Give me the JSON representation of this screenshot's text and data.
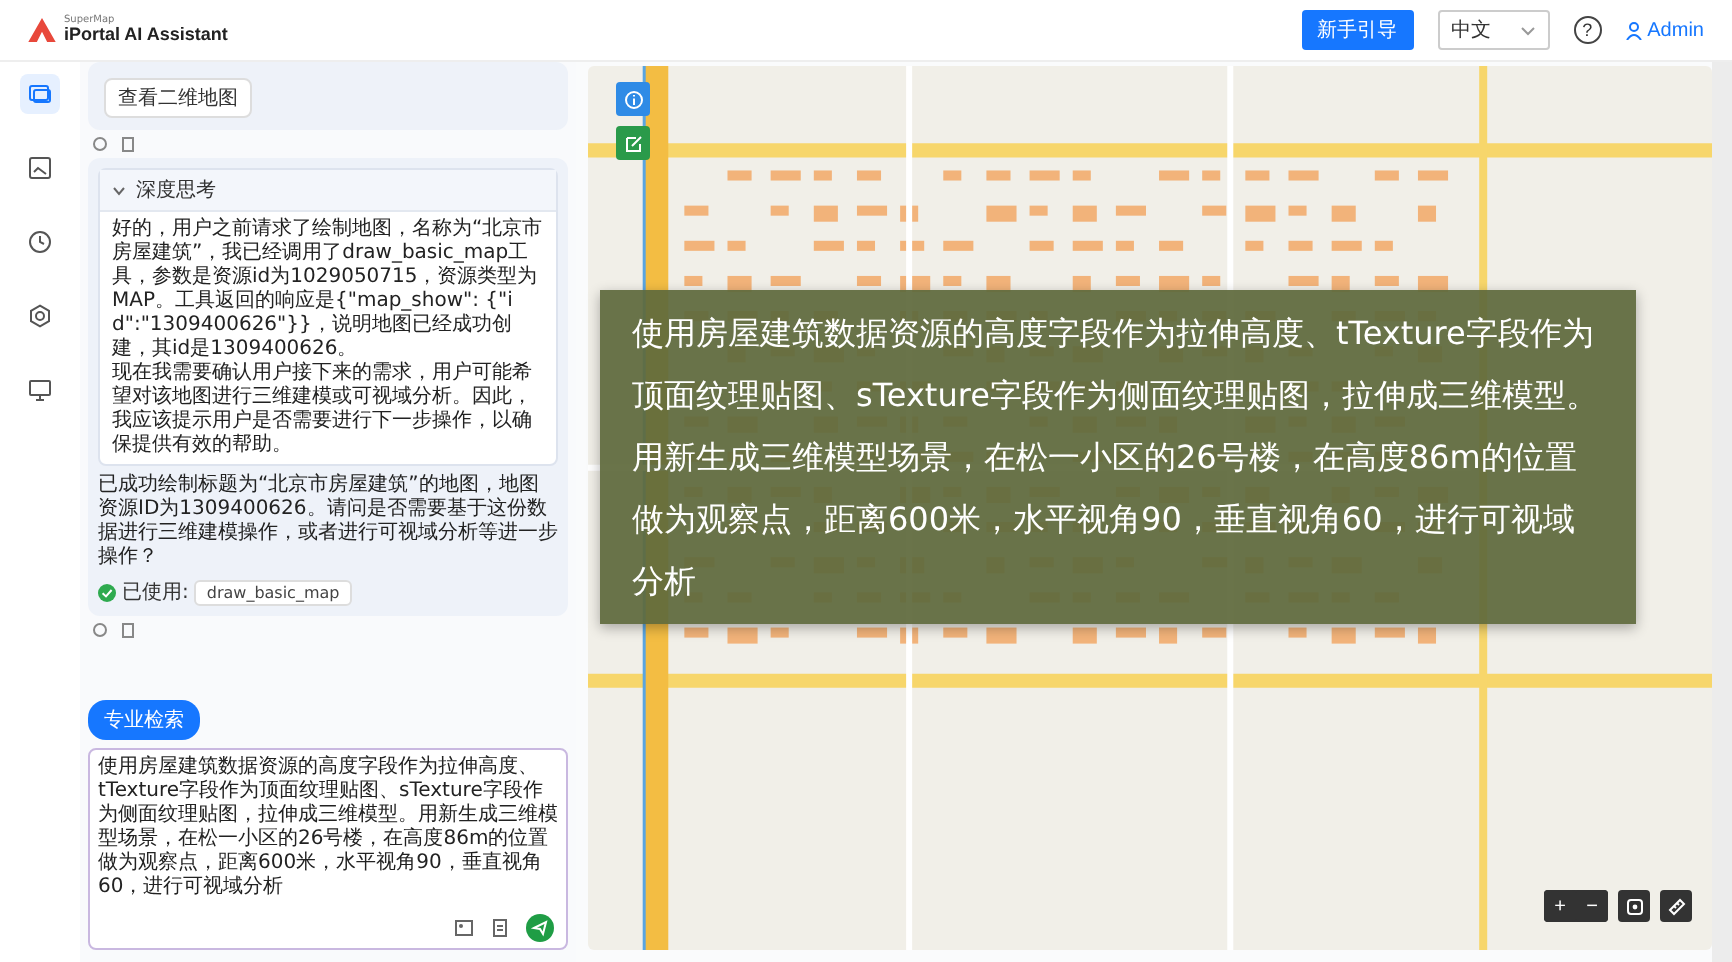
{
  "header": {
    "brand": "SuperMap",
    "title": "iPortal AI Assistant",
    "guide_button": "新手引导",
    "language": "中文",
    "help": "?",
    "user": "Admin"
  },
  "rail": [
    {
      "kind": "chat",
      "selected": true
    },
    {
      "kind": "image",
      "selected": false
    },
    {
      "kind": "history",
      "selected": false
    },
    {
      "kind": "settings",
      "selected": false
    },
    {
      "kind": "monitor",
      "selected": false
    }
  ],
  "chat": {
    "map_button": "查看二维地图",
    "thinking": {
      "title": "深度思考",
      "expanded": true,
      "paragraphs": [
        "好的，用户之前请求了绘制地图，名称为“北京市房屋建筑”，我已经调用了draw_basic_map工具，参数是资源id为1029050715，资源类型为MAP。工具返回的响应是{\"map_show\": {\"id\":\"1309400626\"}}，说明地图已经成功创建，其id是1309400626。",
        "现在我需要确认用户接下来的需求，用户可能希望对该地图进行三维建模或可视域分析。因此，我应该提示用户是否需要进行下一步操作，以确保提供有效的帮助。"
      ]
    },
    "answer": "已成功绘制标题为“北京市房屋建筑”的地图，地图资源ID为1309400626。请问是否需要基于这份数据进行三维建模操作，或者进行可视域分析等进一步操作？",
    "tool": {
      "label": "已使用:",
      "name": "draw_basic_map"
    }
  },
  "mode_button": "专业检索",
  "input": {
    "value": "使用房屋建筑数据资源的高度字段作为拉伸高度、tTexture字段作为顶面纹理贴图、sTexture字段作为侧面纹理贴图，拉伸成三维模型。用新生成三维模型场景，在松一小区的26号楼，在高度86m的位置做为观察点，距离600米，水平视角90，垂直视角60，进行可视域分析"
  },
  "map": {
    "tools": [
      {
        "kind": "info"
      },
      {
        "kind": "edit"
      }
    ],
    "zoom_in": "+",
    "zoom_out": "−"
  },
  "caption": "使用房屋建筑数据资源的高度字段作为拉伸高度、tTexture字段作为顶面纹理贴图、sTexture字段作为侧面纹理贴图，拉伸成三维模型。用新生成三维模型场景，在松一小区的26号楼，在高度86m的位置做为观察点，距离600米，水平视角90，垂直视角60，进行可视域分析"
}
